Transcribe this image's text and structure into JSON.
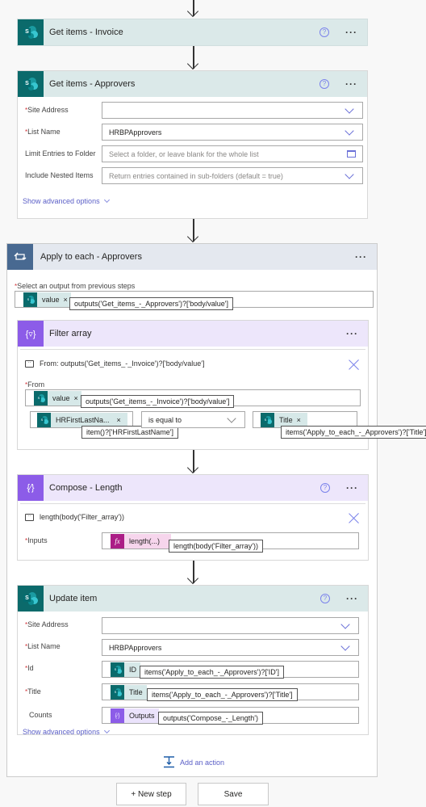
{
  "steps": {
    "get_items_invoice": {
      "title": "Get items - Invoice"
    },
    "get_items_approvers": {
      "title": "Get items - Approvers",
      "fields": [
        {
          "label": "Site Address",
          "required": true,
          "value": "",
          "placeholder": "",
          "control": "dropdown"
        },
        {
          "label": "List Name",
          "required": true,
          "value": "HRBPApprovers",
          "placeholder": "",
          "control": "dropdown"
        },
        {
          "label": "Limit Entries to Folder",
          "required": false,
          "value": "",
          "placeholder": "Select a folder, or leave blank for the whole list",
          "control": "folder-picker"
        },
        {
          "label": "Include Nested Items",
          "required": false,
          "value": "",
          "placeholder": "Return entries contained in sub-folders (default = true)",
          "control": "dropdown"
        }
      ],
      "advanced_label": "Show advanced options"
    },
    "apply_to_each": {
      "title": "Apply to each - Approvers",
      "select_label": "Select an output from previous steps",
      "token": {
        "text": "value",
        "remove": "×",
        "tooltip": "outputs('Get_items_-_Approvers')?['body/value']"
      }
    },
    "filter_array": {
      "title": "Filter array",
      "comment": "From: outputs('Get_items_-_Invoice')?['body/value']",
      "from_label": "From",
      "from_token": {
        "text": "value",
        "remove": "×",
        "tooltip": "outputs('Get_items_-_Invoice')?['body/value']"
      },
      "condition": {
        "left_token": {
          "text": "HRFirstLastNa...",
          "remove": "×",
          "tooltip": "item()?['HRFirstLastName']"
        },
        "operator": "is equal to",
        "right_token": {
          "text": "Title",
          "remove": "×",
          "tooltip": "items('Apply_to_each_-_Approvers')?['Title']"
        }
      }
    },
    "compose_length": {
      "title": "Compose - Length",
      "comment": "length(body('Filter_array'))",
      "inputs_label": "Inputs",
      "token": {
        "text": "length(...)",
        "tooltip": "length(body('Filter_array'))"
      }
    },
    "update_item": {
      "title": "Update item",
      "site_address_label": "Site Address",
      "site_address_value": "",
      "list_name_label": "List Name",
      "list_name_value": "HRBPApprovers",
      "id_label": "Id",
      "id_token": {
        "text": "ID",
        "tooltip": "items('Apply_to_each_-_Approvers')?['ID']"
      },
      "title_label": "Title",
      "title_token": {
        "text": "Title",
        "tooltip": "items('Apply_to_each_-_Approvers')?['Title']"
      },
      "counts_label": "Counts",
      "counts_token": {
        "text": "Outputs",
        "tooltip": "outputs('Compose_-_Length')"
      },
      "advanced_label": "Show advanced options"
    }
  },
  "add_action_label": "Add an action",
  "footer": {
    "new_step_label": "+ New step",
    "save_label": "Save"
  },
  "common": {
    "required_mark": "*",
    "help_glyph": "?",
    "more_glyph": "···"
  },
  "colors": {
    "sharepoint": "#0b6a6b",
    "loop": "#486991",
    "data_operation": "#8c5ce8",
    "expression": "#ab1e86",
    "link": "#5b5fc7",
    "required": "#d13438"
  }
}
